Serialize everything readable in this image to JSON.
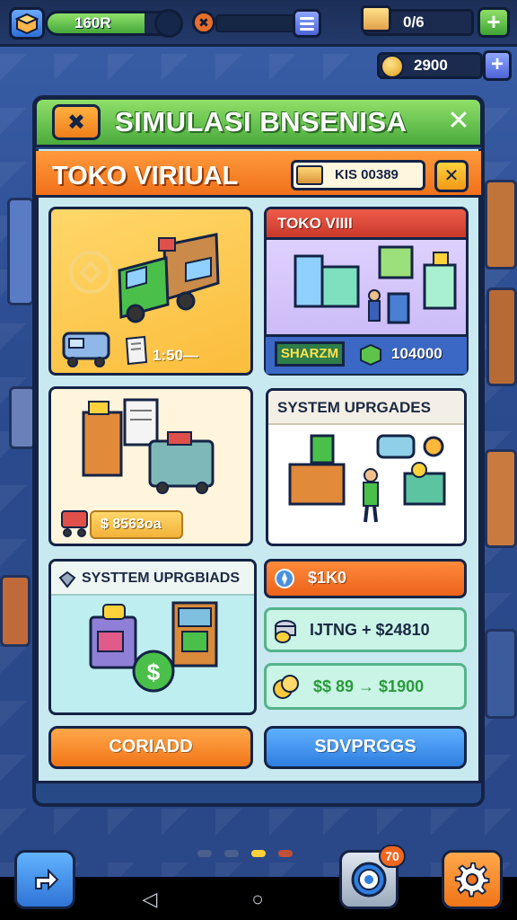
{
  "hud": {
    "xp_value": "160R",
    "xp_fill": 0.75,
    "box_count": "0/6",
    "coins": "2900"
  },
  "panel": {
    "title": "SIMULASI BNSENISA",
    "close_label": "✕"
  },
  "shop": {
    "title": "TOKO VIRIUAL",
    "chip_value": "KIS 00389",
    "close_label": "✕"
  },
  "cards": {
    "delivery": {
      "price": "1:50—"
    },
    "toko": {
      "title": "TOKO VIIII",
      "badge": "SHARZM",
      "value": "104000"
    },
    "storage": {
      "price": "$ 8563oa"
    },
    "upgrades": {
      "title": "SYSTEM UPRGADES"
    },
    "upgrades2": {
      "title": "SYSTTEM UPRGBIADS"
    }
  },
  "rows": {
    "orange": "$1K0",
    "mint1": "IJTNG + $24810",
    "mint2": "$$ 89 → $1900"
  },
  "buttons": {
    "left": "CORIADD",
    "right": "SDVPRGGS"
  },
  "bottom": {
    "badge": "70"
  },
  "colors": {
    "accent_green": "#4aaa3c",
    "accent_orange": "#f0711a",
    "accent_blue": "#2f7ee0",
    "background": "#2f4f95"
  }
}
